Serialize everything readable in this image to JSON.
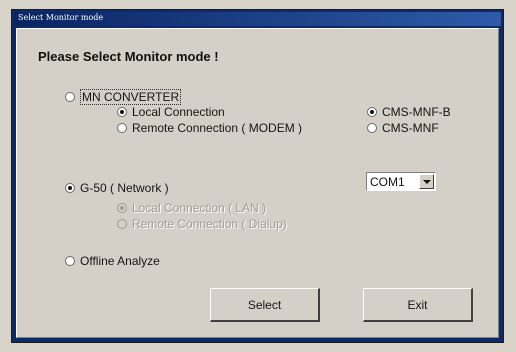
{
  "window": {
    "title": "Select Monitor mode"
  },
  "heading": "Please Select Monitor mode !",
  "options": {
    "mn_converter": {
      "label": "MN CONVERTER",
      "checked": false
    },
    "local_connection": {
      "label": "Local Connection",
      "checked": true
    },
    "remote_connection_modem": {
      "label": "Remote Connection ( MODEM )",
      "checked": false
    },
    "cms_mnf_b": {
      "label": "CMS-MNF-B",
      "checked": true
    },
    "cms_mnf": {
      "label": "CMS-MNF",
      "checked": false
    },
    "g50_network": {
      "label": "G-50 ( Network )",
      "checked": true
    },
    "local_connection_lan": {
      "label": "Local Connection   ( LAN )",
      "checked": true,
      "enabled": false
    },
    "remote_connection_dialup": {
      "label": "Remote Connection ( Dialup)",
      "checked": false,
      "enabled": false
    },
    "offline_analyze": {
      "label": "Offline Analyze",
      "checked": false
    }
  },
  "com_port": {
    "selected": "COM1"
  },
  "buttons": {
    "select": "Select",
    "exit": "Exit"
  },
  "colors": {
    "title_bar": "#0d2a63",
    "dialog_face": "#d4d0c8",
    "disabled_text": "#a09c94"
  }
}
